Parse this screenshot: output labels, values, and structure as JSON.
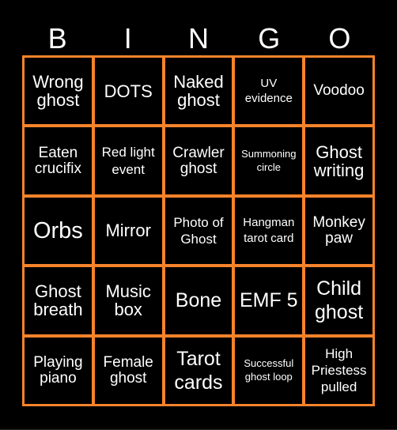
{
  "card": {
    "accent_color": "#f7832a",
    "background_color": "#000000",
    "header": [
      "B",
      "I",
      "N",
      "G",
      "O"
    ],
    "cells": [
      "Wrong ghost",
      "DOTS",
      "Naked ghost",
      "UV evidence",
      "Voodoo",
      "Eaten crucifix",
      "Red light event",
      "Crawler ghost",
      "Summoning circle",
      "Ghost writing",
      "Orbs",
      "Mirror",
      "Photo of Ghost",
      "Hangman tarot card",
      "Monkey paw",
      "Ghost breath",
      "Music box",
      "Bone",
      "EMF 5",
      "Child ghost",
      "Playing piano",
      "Female ghost",
      "Tarot cards",
      "Successful ghost loop",
      "High Priestess pulled"
    ]
  }
}
